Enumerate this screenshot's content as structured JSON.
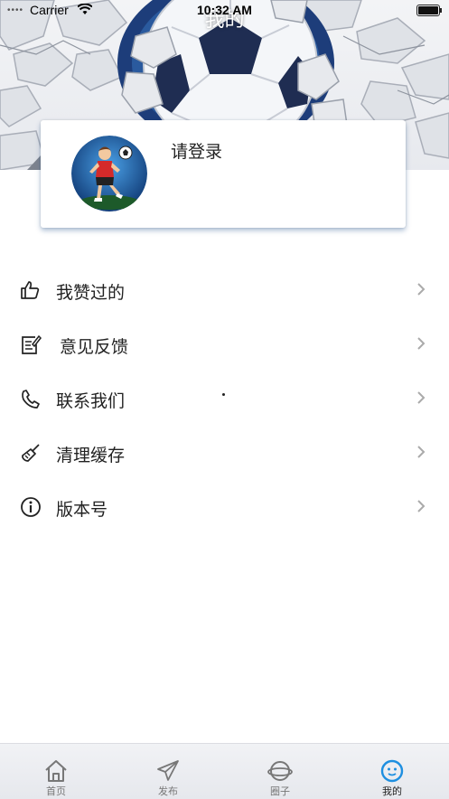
{
  "status_bar": {
    "carrier": "Carrier",
    "time": "10:32 AM"
  },
  "header": {
    "title": "我的"
  },
  "profile": {
    "login_label": "请登录"
  },
  "menu": [
    {
      "label": "我赞过的",
      "icon": "thumbs-up-icon"
    },
    {
      "label": "意见反馈",
      "icon": "feedback-edit-icon"
    },
    {
      "label": "联系我们",
      "icon": "phone-icon"
    },
    {
      "label": "清理缓存",
      "icon": "broom-icon"
    },
    {
      "label": "版本号",
      "icon": "info-icon"
    }
  ],
  "tab_bar": [
    {
      "label": "首页",
      "icon": "home-icon"
    },
    {
      "label": "发布",
      "icon": "paper-plane-icon"
    },
    {
      "label": "圈子",
      "icon": "planet-icon"
    },
    {
      "label": "我的",
      "icon": "smiley-icon",
      "active": true
    }
  ],
  "colors": {
    "accent": "#1e8fe0",
    "banner_blue": "#1d3d7a",
    "card_shadow": "#466ea0"
  }
}
